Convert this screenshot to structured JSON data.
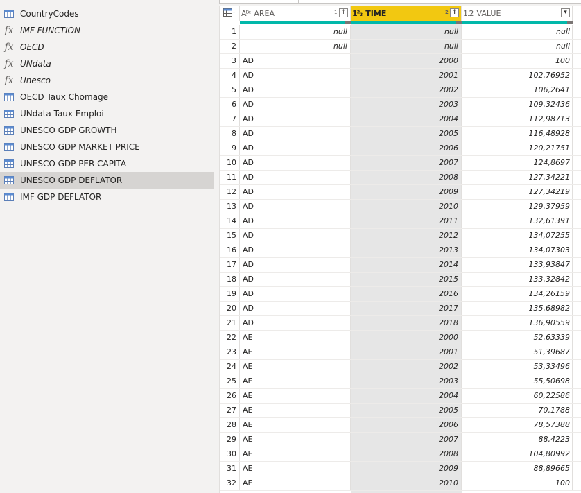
{
  "queries": [
    {
      "label": "CountryCodes",
      "type": "table",
      "selected": false
    },
    {
      "label": "IMF FUNCTION",
      "type": "function",
      "selected": false
    },
    {
      "label": "OECD",
      "type": "function",
      "selected": false
    },
    {
      "label": "UNdata",
      "type": "function",
      "selected": false
    },
    {
      "label": "Unesco",
      "type": "function",
      "selected": false
    },
    {
      "label": "OECD Taux Chomage",
      "type": "table",
      "selected": false
    },
    {
      "label": "UNdata Taux Emploi",
      "type": "table",
      "selected": false
    },
    {
      "label": "UNESCO GDP GROWTH",
      "type": "table",
      "selected": false
    },
    {
      "label": "UNESCO GDP MARKET PRICE",
      "type": "table",
      "selected": false
    },
    {
      "label": "UNESCO GDP PER CAPITA",
      "type": "table",
      "selected": false
    },
    {
      "label": "UNESCO GDP DEFLATOR",
      "type": "table",
      "selected": true
    },
    {
      "label": "IMF GDP DEFLATOR",
      "type": "table",
      "selected": false
    }
  ],
  "fx_symbol": "fx",
  "grid": {
    "table_icon": "table-icon",
    "columns": [
      {
        "key": "area",
        "type_glyph": "Aᴮᶜ",
        "label": "AREA",
        "sort_order": "1",
        "sort_glyph": "↑",
        "highlighted": false
      },
      {
        "key": "time",
        "type_glyph": "1²₃",
        "label": "TIME",
        "sort_order": "2",
        "sort_glyph": "↑",
        "highlighted": true
      },
      {
        "key": "value",
        "type_glyph": "1.2",
        "label": "VALUE",
        "sort_order": "",
        "sort_glyph": "▾",
        "highlighted": false
      }
    ],
    "rows": [
      {
        "n": "1",
        "area": "",
        "time": "null",
        "value": "null",
        "area_null": "null"
      },
      {
        "n": "2",
        "area": "",
        "time": "null",
        "value": "null",
        "area_null": "null"
      },
      {
        "n": "3",
        "area": "AD",
        "time": "2000",
        "value": "100"
      },
      {
        "n": "4",
        "area": "AD",
        "time": "2001",
        "value": "102,76952"
      },
      {
        "n": "5",
        "area": "AD",
        "time": "2002",
        "value": "106,2641"
      },
      {
        "n": "6",
        "area": "AD",
        "time": "2003",
        "value": "109,32436"
      },
      {
        "n": "7",
        "area": "AD",
        "time": "2004",
        "value": "112,98713"
      },
      {
        "n": "8",
        "area": "AD",
        "time": "2005",
        "value": "116,48928"
      },
      {
        "n": "9",
        "area": "AD",
        "time": "2006",
        "value": "120,21751"
      },
      {
        "n": "10",
        "area": "AD",
        "time": "2007",
        "value": "124,8697"
      },
      {
        "n": "11",
        "area": "AD",
        "time": "2008",
        "value": "127,34221"
      },
      {
        "n": "12",
        "area": "AD",
        "time": "2009",
        "value": "127,34219"
      },
      {
        "n": "13",
        "area": "AD",
        "time": "2010",
        "value": "129,37959"
      },
      {
        "n": "14",
        "area": "AD",
        "time": "2011",
        "value": "132,61391"
      },
      {
        "n": "15",
        "area": "AD",
        "time": "2012",
        "value": "134,07255"
      },
      {
        "n": "16",
        "area": "AD",
        "time": "2013",
        "value": "134,07303"
      },
      {
        "n": "17",
        "area": "AD",
        "time": "2014",
        "value": "133,93847"
      },
      {
        "n": "18",
        "area": "AD",
        "time": "2015",
        "value": "133,32842"
      },
      {
        "n": "19",
        "area": "AD",
        "time": "2016",
        "value": "134,26159"
      },
      {
        "n": "20",
        "area": "AD",
        "time": "2017",
        "value": "135,68982"
      },
      {
        "n": "21",
        "area": "AD",
        "time": "2018",
        "value": "136,90559"
      },
      {
        "n": "22",
        "area": "AE",
        "time": "2000",
        "value": "52,63339"
      },
      {
        "n": "23",
        "area": "AE",
        "time": "2001",
        "value": "51,39687"
      },
      {
        "n": "24",
        "area": "AE",
        "time": "2002",
        "value": "53,33496"
      },
      {
        "n": "25",
        "area": "AE",
        "time": "2003",
        "value": "55,50698"
      },
      {
        "n": "26",
        "area": "AE",
        "time": "2004",
        "value": "60,22586"
      },
      {
        "n": "27",
        "area": "AE",
        "time": "2005",
        "value": "70,1788"
      },
      {
        "n": "28",
        "area": "AE",
        "time": "2006",
        "value": "78,57388"
      },
      {
        "n": "29",
        "area": "AE",
        "time": "2007",
        "value": "88,4223"
      },
      {
        "n": "30",
        "area": "AE",
        "time": "2008",
        "value": "104,80992"
      },
      {
        "n": "31",
        "area": "AE",
        "time": "2009",
        "value": "88,89665"
      },
      {
        "n": "32",
        "area": "AE",
        "time": "2010",
        "value": "100"
      }
    ]
  },
  "colors": {
    "selected_column": "#f2c811",
    "quality_valid": "#01b8aa",
    "quality_error": "#7a7574",
    "selected_query_bg": "#d6d4d2"
  }
}
